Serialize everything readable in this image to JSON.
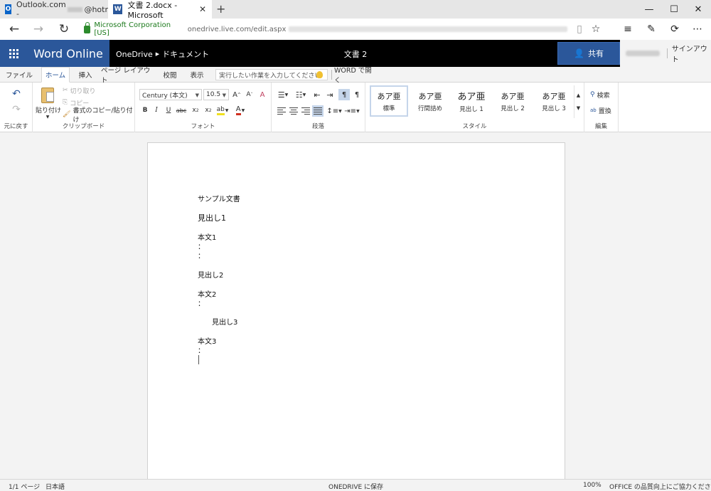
{
  "browser": {
    "tabs": [
      {
        "label": "Outlook.com - ",
        "suffix": "@hotr",
        "icon": "outlook-icon"
      },
      {
        "label": "文書 2.docx - Microsoft",
        "icon": "word-icon",
        "active": true
      }
    ],
    "cert": "Microsoft Corporation [US]",
    "url": "onedrive.live.com/edit.aspx"
  },
  "office": {
    "brand": "Word Online",
    "breadcrumb": [
      "OneDrive",
      "ドキュメント"
    ],
    "doc_title": "文書 2",
    "share_label": "共有",
    "signin_label": "サインアウト"
  },
  "ribbon_tabs": {
    "file": "ファイル",
    "home": "ホーム",
    "insert": "挿入",
    "layout": "ページ レイアウト",
    "review": "校閲",
    "view": "表示",
    "tell_me": "実行したい作業を入力してください",
    "open_word": "WORD で開く"
  },
  "ribbon": {
    "undo_group": "元に戻す",
    "clipboard": {
      "paste": "貼り付け",
      "cut": "切り取り",
      "copy": "コピー",
      "format_painter": "書式のコピー/貼り付け",
      "label": "クリップボード"
    },
    "font": {
      "name": "Century (本文)",
      "size": "10.5",
      "label": "フォント"
    },
    "paragraph": {
      "label": "段落"
    },
    "styles": {
      "label": "スタイル",
      "sample": "あア亜",
      "items": [
        "標準",
        "行間詰め",
        "見出し 1",
        "見出し 2",
        "見出し 3"
      ]
    },
    "editing": {
      "find": "検索",
      "replace": "置換",
      "label": "編集"
    }
  },
  "document": {
    "lines": [
      "サンプル文書",
      "見出し1",
      "本文1",
      "：",
      "：",
      "見出し2",
      "本文2",
      "：",
      "見出し3",
      "本文3",
      "："
    ]
  },
  "status": {
    "page": "1/1 ページ",
    "language": "日本語",
    "save_state": "ONEDRIVE に保存",
    "zoom": "100%",
    "feedback": "OFFICE の品質向上にご協力ください"
  }
}
